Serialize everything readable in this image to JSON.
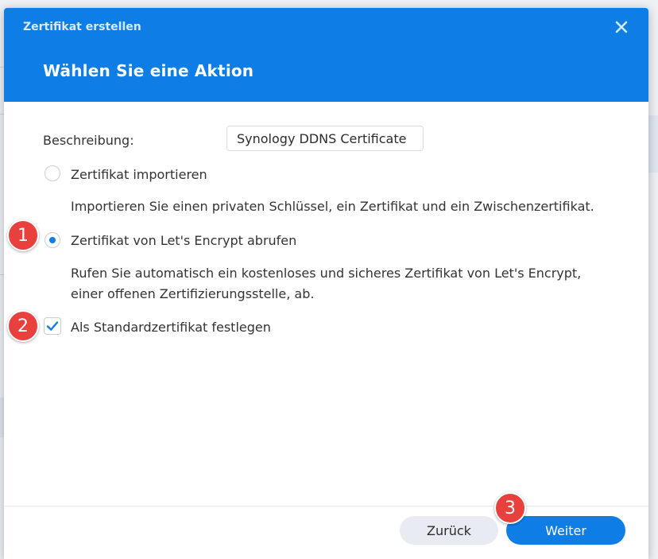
{
  "window": {
    "title": "Zertifikat erstellen",
    "heading": "Wählen Sie eine Aktion"
  },
  "form": {
    "description_label": "Beschreibung:",
    "description_value": "Synology DDNS Certificate",
    "options": [
      {
        "label": "Zertifikat importieren",
        "help": "Importieren Sie einen privaten Schlüssel, ein Zertifikat und ein Zwischenzertifikat.",
        "selected": false
      },
      {
        "label": "Zertifikat von Let's Encrypt abrufen",
        "help_line1": "Rufen Sie automatisch ein kostenloses und sicheres Zertifikat von Let's Encrypt,",
        "help_line2": "einer offenen Zertifizierungsstelle, ab.",
        "selected": true
      }
    ],
    "default_checkbox": {
      "label": "Als Standardzertifikat festlegen",
      "checked": true
    }
  },
  "footer": {
    "back_label": "Zurück",
    "next_label": "Weiter"
  },
  "badges": [
    "1",
    "2",
    "3"
  ],
  "icons": {
    "close": "close-icon",
    "check": "check-icon"
  },
  "colors": {
    "accent": "#0e7ee6",
    "badge": "#e8403d",
    "back_button": "#e8ecf2"
  }
}
